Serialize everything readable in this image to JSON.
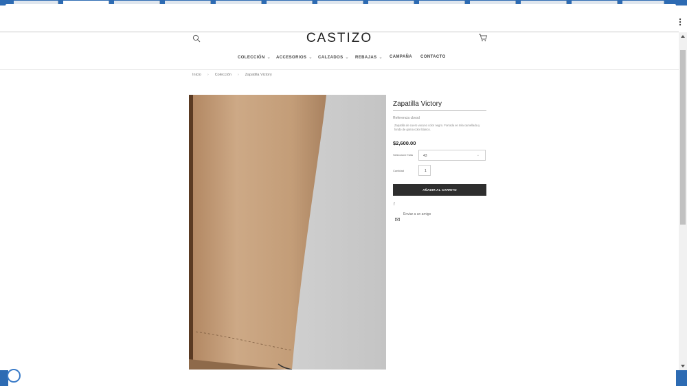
{
  "site": {
    "logo": "CASTIZO",
    "nav": [
      {
        "label": "COLECCIÓN",
        "caret": "⌄"
      },
      {
        "label": "ACCESORIOS",
        "caret": "⌄"
      },
      {
        "label": "CALZADOS",
        "caret": "⌄"
      },
      {
        "label": "REBAJAS",
        "caret": "⌄"
      },
      {
        "label": "CAMPAÑA"
      },
      {
        "label": "CONTACTO"
      }
    ]
  },
  "breadcrumb": {
    "items": [
      "Inicio",
      "Colección",
      "Zapatilla Victory"
    ],
    "separator": "›"
  },
  "product": {
    "title": "Zapatilla Victory",
    "reference": "Referencia cbvod",
    "description": "Zapatilla de cuero vacuno color negro. Forrada en tela camellada y fondo de goma color blanco.",
    "price": "$2,600.00",
    "size_label": "Seleccione Talla",
    "size_value": "43",
    "size_caret": "⌄",
    "qty_label": "Cantidad",
    "qty_value": "1",
    "add_to_cart": "AÑADIR AL CARRITO",
    "facebook_glyph": "f",
    "send_friend": "Enviar a un amigo"
  },
  "icons": {
    "search": "search-icon",
    "cart": "cart-icon",
    "facebook": "facebook-icon",
    "mail": "mail-icon"
  },
  "colors": {
    "button_bg": "#2e2e2e",
    "image_fabric": "#c7a27c",
    "image_background": "#c9c9c9"
  }
}
